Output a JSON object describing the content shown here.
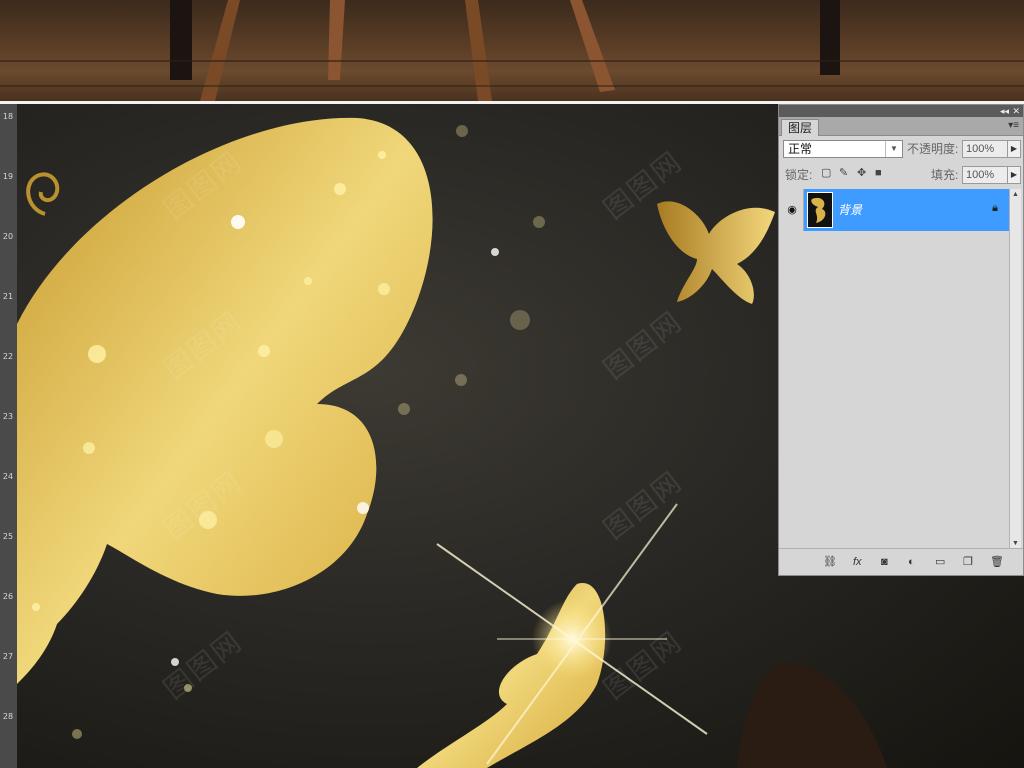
{
  "layers_panel": {
    "tab_label": "图层",
    "collapse_label": "◂◂",
    "close_label": "✕",
    "menu_label": "▾≡",
    "blend_mode": "正常",
    "opacity_label": "不透明度:",
    "opacity_value": "100%",
    "lock_label": "锁定:",
    "fill_label": "填充:",
    "fill_value": "100%",
    "layers": [
      {
        "name": "背景",
        "visible": true,
        "locked": true
      }
    ],
    "footer_icons": [
      "link-icon",
      "fx-icon",
      "mask-icon",
      "adjustment-icon",
      "group-icon",
      "new-layer-icon",
      "trash-icon"
    ]
  },
  "ruler": {
    "labels": [
      "18",
      "19",
      "20",
      "21",
      "22",
      "23",
      "24",
      "25",
      "26",
      "27",
      "28"
    ]
  },
  "watermark_text": "图图网",
  "colors": {
    "selection_blue": "#3e9bff",
    "panel_bg": "#d6d6d6",
    "gold": "#e6c35a"
  }
}
